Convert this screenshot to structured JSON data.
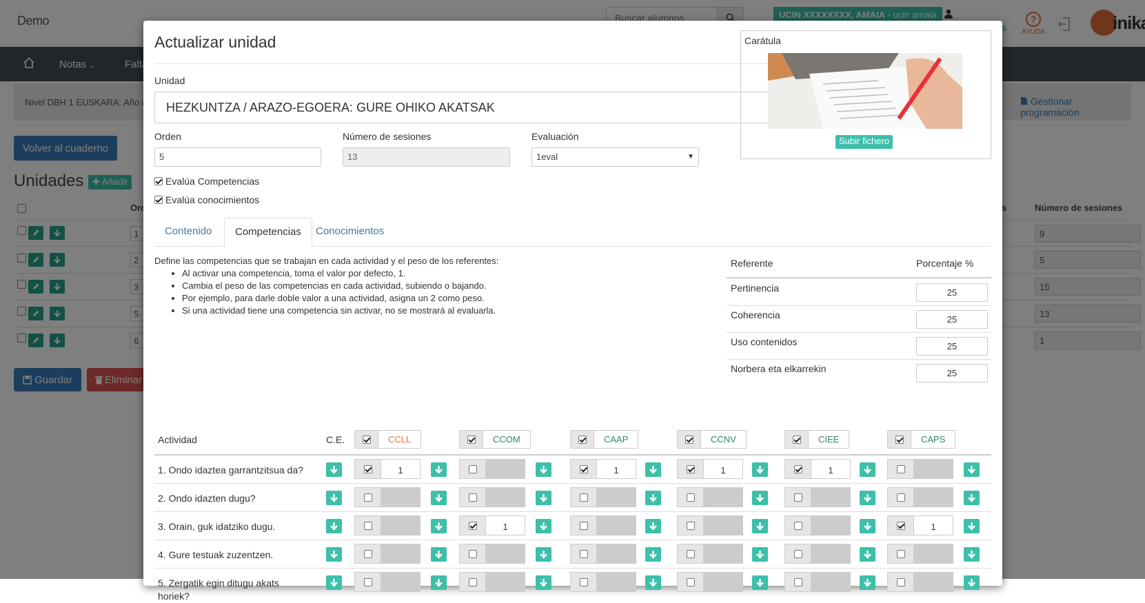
{
  "app": {
    "brand": "Demo",
    "search_placeholder": "Buscar alumnos",
    "user_name": "UCIN XXXXXXXX, AMAIA",
    "user_login": "ucin amaia",
    "help_label": "AYUDA",
    "logo_text": "inika",
    "partial_link": "s"
  },
  "nav": {
    "notas": "Notas",
    "faltas": "Falta"
  },
  "level": {
    "text": "Nivel DBH 1 EUSKARA: Año a",
    "manage": "Gestionar programación"
  },
  "page": {
    "back_button": "Volver al cuaderno",
    "units_title": "Unidades",
    "add_button": "Añadir",
    "col_order": "Ord",
    "col_partial": "s",
    "col_sessions": "Número de sesiones",
    "rows": [
      {
        "order": "1",
        "sessions": "9"
      },
      {
        "order": "2",
        "sessions": "5"
      },
      {
        "order": "3",
        "sessions": "15"
      },
      {
        "order": "5",
        "sessions": "13"
      },
      {
        "order": "6",
        "sessions": "1"
      }
    ],
    "save_button": "Guardar",
    "delete_button": "Eliminar"
  },
  "modal": {
    "title": "Actualizar unidad",
    "unit_label": "Unidad",
    "unit_value": "HEZKUNTZA / ARAZO-EGOERA: GURE OHIKO AKATSAK",
    "order_label": "Orden",
    "order_value": "5",
    "sessions_label": "Número de sesiones",
    "sessions_value": "13",
    "eval_label": "Evaluación",
    "eval_value": "1eval",
    "chk_competencias": "Evalúa Competencias",
    "chk_conocimientos": "Evalúa conocimientos",
    "cover_label": "Carátula",
    "upload_button": "Subir fichero",
    "tabs": [
      "Contenido",
      "Competencias",
      "Conocimientos"
    ],
    "info_intro": "Define las competencias que se trabajan en cada actividad y el peso de los referentes:",
    "info_bullets": [
      "Al activar una competencia, toma el valor por defecto, 1.",
      "Cambia el peso de las competencias en cada actividad, subiendo o bajando.",
      "Por ejemplo, para darle doble valor a una actividad, asigna un 2 como peso.",
      "Si una actividad tiene una competencia sin activar, no se mostrará al evaluarla."
    ],
    "ref_header": "Referente",
    "pct_header": "Porcentaje %",
    "referentes": [
      {
        "name": "Pertinencia",
        "pct": "25"
      },
      {
        "name": "Coherencia",
        "pct": "25"
      },
      {
        "name": "Uso contenidos",
        "pct": "25"
      },
      {
        "name": "Norbera eta elkarrekin",
        "pct": "25"
      }
    ],
    "activity_header": "Actividad",
    "ce_header": "C.E.",
    "competencies": [
      {
        "code": "CCLL",
        "color": "#e8743b"
      },
      {
        "code": "CCOM",
        "color": "#2e8b57"
      },
      {
        "code": "CAAP",
        "color": "#2e8b57"
      },
      {
        "code": "CCNV",
        "color": "#2e8b57"
      },
      {
        "code": "CIEE",
        "color": "#2e8b57"
      },
      {
        "code": "CAPS",
        "color": "#2e8b57"
      }
    ],
    "activities": [
      {
        "name": "1. Ondo idaztea garrantzitsua da?",
        "values": [
          "1",
          "",
          "1",
          "1",
          "1",
          ""
        ]
      },
      {
        "name": "2. Ondo idazten dugu?",
        "values": [
          "",
          "",
          "",
          "",
          "",
          ""
        ]
      },
      {
        "name": "3. Orain, guk idatziko dugu.",
        "values": [
          "",
          "1",
          "",
          "",
          "",
          "1"
        ]
      },
      {
        "name": "4. Gure testuak zuzentzen.",
        "values": [
          "",
          "",
          "",
          "",
          "",
          ""
        ]
      },
      {
        "name": "5. Zergatik egin ditugu akats horiek?",
        "values": [
          "",
          "",
          "",
          "",
          "",
          ""
        ]
      }
    ]
  },
  "colors": {
    "teal": "#3dbfa9",
    "primary": "#3a7ab8",
    "danger": "#d9534f",
    "navbar": "#444c53",
    "accent": "#e06a3b"
  }
}
